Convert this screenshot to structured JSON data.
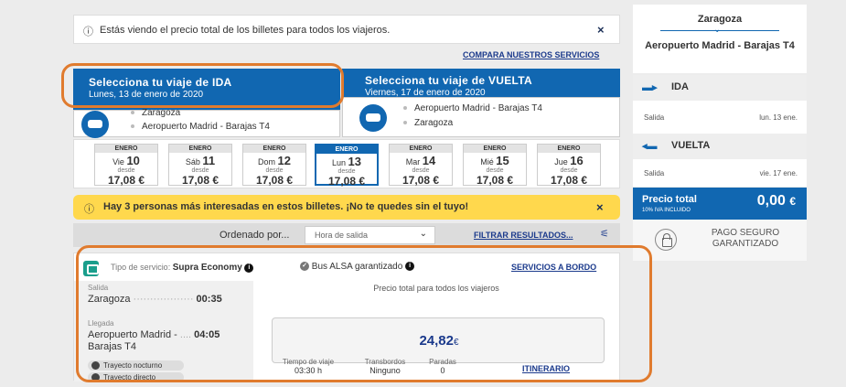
{
  "info_bar": {
    "text": "Estás viendo el precio total de los billetes para todos los viajeros.",
    "close": "×"
  },
  "compare_link": "COMPARA NUESTROS SERVICIOS",
  "tab_ida": {
    "title": "Selecciona tu viaje de IDA",
    "date": "Lunes, 13 de enero de 2020",
    "origin": "Zaragoza",
    "destination": "Aeropuerto Madrid - Barajas T4"
  },
  "tab_vuelta": {
    "title": "Selecciona tu viaje de VUELTA",
    "date": "Viernes, 17 de enero de 2020",
    "origin": "Aeropuerto Madrid - Barajas T4",
    "destination": "Zaragoza"
  },
  "days": [
    {
      "month": "ENERO",
      "weekday": "Vie",
      "day": "10",
      "desde": "desde",
      "price": "17,08 €"
    },
    {
      "month": "ENERO",
      "weekday": "Sáb",
      "day": "11",
      "desde": "desde",
      "price": "17,08 €"
    },
    {
      "month": "ENERO",
      "weekday": "Dom",
      "day": "12",
      "desde": "desde",
      "price": "17,08 €"
    },
    {
      "month": "ENERO",
      "weekday": "Lun",
      "day": "13",
      "desde": "desde",
      "price": "17,08 €"
    },
    {
      "month": "ENERO",
      "weekday": "Mar",
      "day": "14",
      "desde": "desde",
      "price": "17,08 €"
    },
    {
      "month": "ENERO",
      "weekday": "Mié",
      "day": "15",
      "desde": "desde",
      "price": "17,08 €"
    },
    {
      "month": "ENERO",
      "weekday": "Jue",
      "day": "16",
      "desde": "desde",
      "price": "17,08 €"
    }
  ],
  "promo": {
    "text": "Hay 3 personas más interesadas en estos billetes. ¡No te quedes sin el tuyo!",
    "close": "×"
  },
  "sort": {
    "label": "Ordenado por...",
    "value": "Hora de salida",
    "filter": "FILTRAR RESULTADOS..."
  },
  "result": {
    "service_label": "Tipo de servicio:",
    "service_value": "Supra Economy",
    "guarantee": "Bus ALSA garantizado",
    "onboard_link": "SERVICIOS A BORDO",
    "salida_label": "Salida",
    "salida_place": "Zaragoza",
    "salida_time": "00:35",
    "llegada_label": "Llegada",
    "llegada_place_1": "Aeropuerto Madrid -",
    "llegada_place_2": "Barajas T4",
    "llegada_time": "04:05",
    "tag_1": "Trayecto nocturno",
    "tag_2": "Trayecto directo",
    "price_caption": "Precio total para todos los viajeros",
    "price": "24,82",
    "currency": "€",
    "travel_time_label": "Tiempo de viaje",
    "travel_time": "03:30 h",
    "transfers_label": "Transbordos",
    "transfers": "Ninguno",
    "stops_label": "Paradas",
    "stops": "0",
    "itinerary_link": "ITINERARIO"
  },
  "sidebar": {
    "origin": "Zaragoza",
    "destination": "Aeropuerto Madrid - Barajas T4",
    "ida_title": "IDA",
    "ida_label": "Salida",
    "ida_date": "lun. 13 ene.",
    "vuelta_title": "VUELTA",
    "vuelta_label": "Salida",
    "vuelta_date": "vie. 17 ene.",
    "total_label": "Precio total",
    "total_sub": "10% IVA INCLUIDO",
    "total_value": "0,00",
    "total_currency": "€",
    "secure_1": "PAGO SEGURO",
    "secure_2": "GARANTIZADO"
  },
  "colors": {
    "brand_blue": "#1167b1",
    "promo_yellow": "#ffd84d",
    "annotation_orange": "#e07b2e",
    "service_teal": "#1a9e8c"
  }
}
